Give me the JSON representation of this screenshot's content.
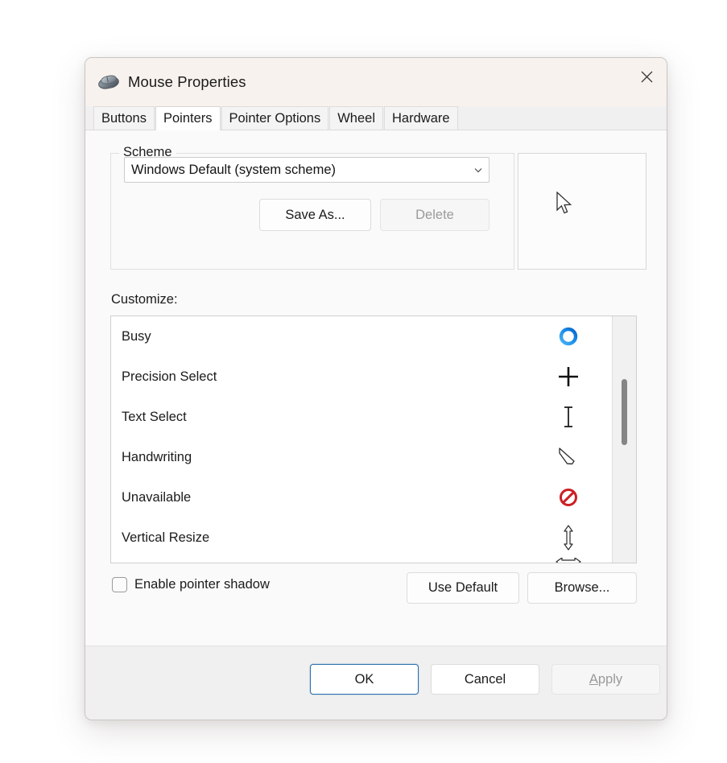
{
  "window": {
    "title": "Mouse Properties",
    "icon": "mouse-icon",
    "close_label": "✕"
  },
  "tabs": [
    {
      "label": "Buttons",
      "active": false
    },
    {
      "label": "Pointers",
      "active": true
    },
    {
      "label": "Pointer Options",
      "active": false
    },
    {
      "label": "Wheel",
      "active": false
    },
    {
      "label": "Hardware",
      "active": false
    }
  ],
  "scheme": {
    "group_title": "Scheme",
    "selected": "Windows Default (system scheme)",
    "dropdown_icon": "chevron-down-icon",
    "save_as_label": "Save As...",
    "delete_label": "Delete",
    "delete_enabled": false,
    "preview_cursor": "arrow-cursor"
  },
  "customize": {
    "label": "Customize:",
    "items": [
      {
        "name": "Busy",
        "cursor": "busy-ring-cursor"
      },
      {
        "name": "Precision Select",
        "cursor": "crosshair-cursor"
      },
      {
        "name": "Text Select",
        "cursor": "ibeam-cursor"
      },
      {
        "name": "Handwriting",
        "cursor": "pen-cursor"
      },
      {
        "name": "Unavailable",
        "cursor": "prohibited-cursor"
      },
      {
        "name": "Vertical Resize",
        "cursor": "vertical-resize-cursor"
      }
    ]
  },
  "options": {
    "pointer_shadow_label": "Enable pointer shadow",
    "pointer_shadow_checked": false,
    "use_default_label": "Use Default",
    "browse_label": "Browse..."
  },
  "footer": {
    "ok_label": "OK",
    "cancel_label": "Cancel",
    "apply_label": "Apply",
    "apply_accel": "A",
    "apply_rest": "pply",
    "apply_enabled": false
  },
  "colors": {
    "titlebar": "#f8f2ee",
    "dialog_bg": "#f3f3f3",
    "content_bg": "#fafafa",
    "footer_bg": "#f0f0f0",
    "accent_focus": "#2a6fad",
    "busy_blue": "#0a84e0",
    "unavailable_red": "#cc1f25",
    "scrollbar_thumb": "#868686"
  }
}
